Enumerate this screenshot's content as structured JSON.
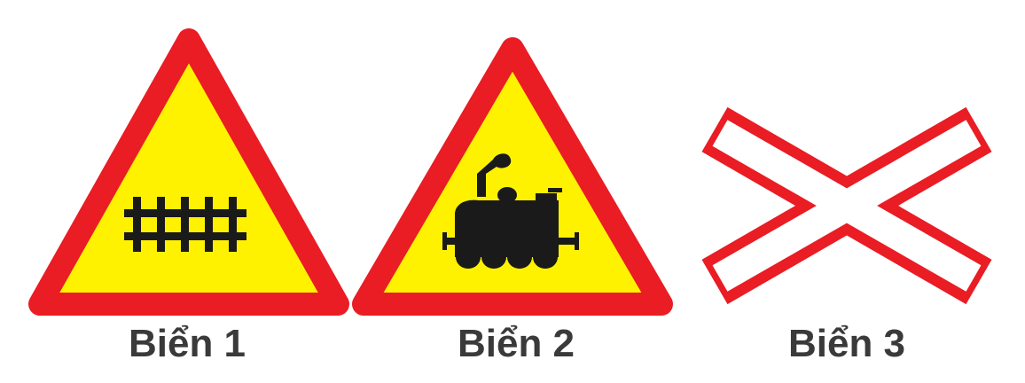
{
  "signs": [
    {
      "label": "Biển 1",
      "icon": "railway-track-icon"
    },
    {
      "label": "Biển 2",
      "icon": "steam-locomotive-icon"
    },
    {
      "label": "Biển 3",
      "icon": "saint-andrew-cross-icon"
    }
  ],
  "colors": {
    "border_red": "#ea1c24",
    "fill_yellow": "#fff200",
    "symbol_black": "#1a1a1a",
    "cross_fill": "#ffffff",
    "caption_text": "#3a3a3a"
  }
}
